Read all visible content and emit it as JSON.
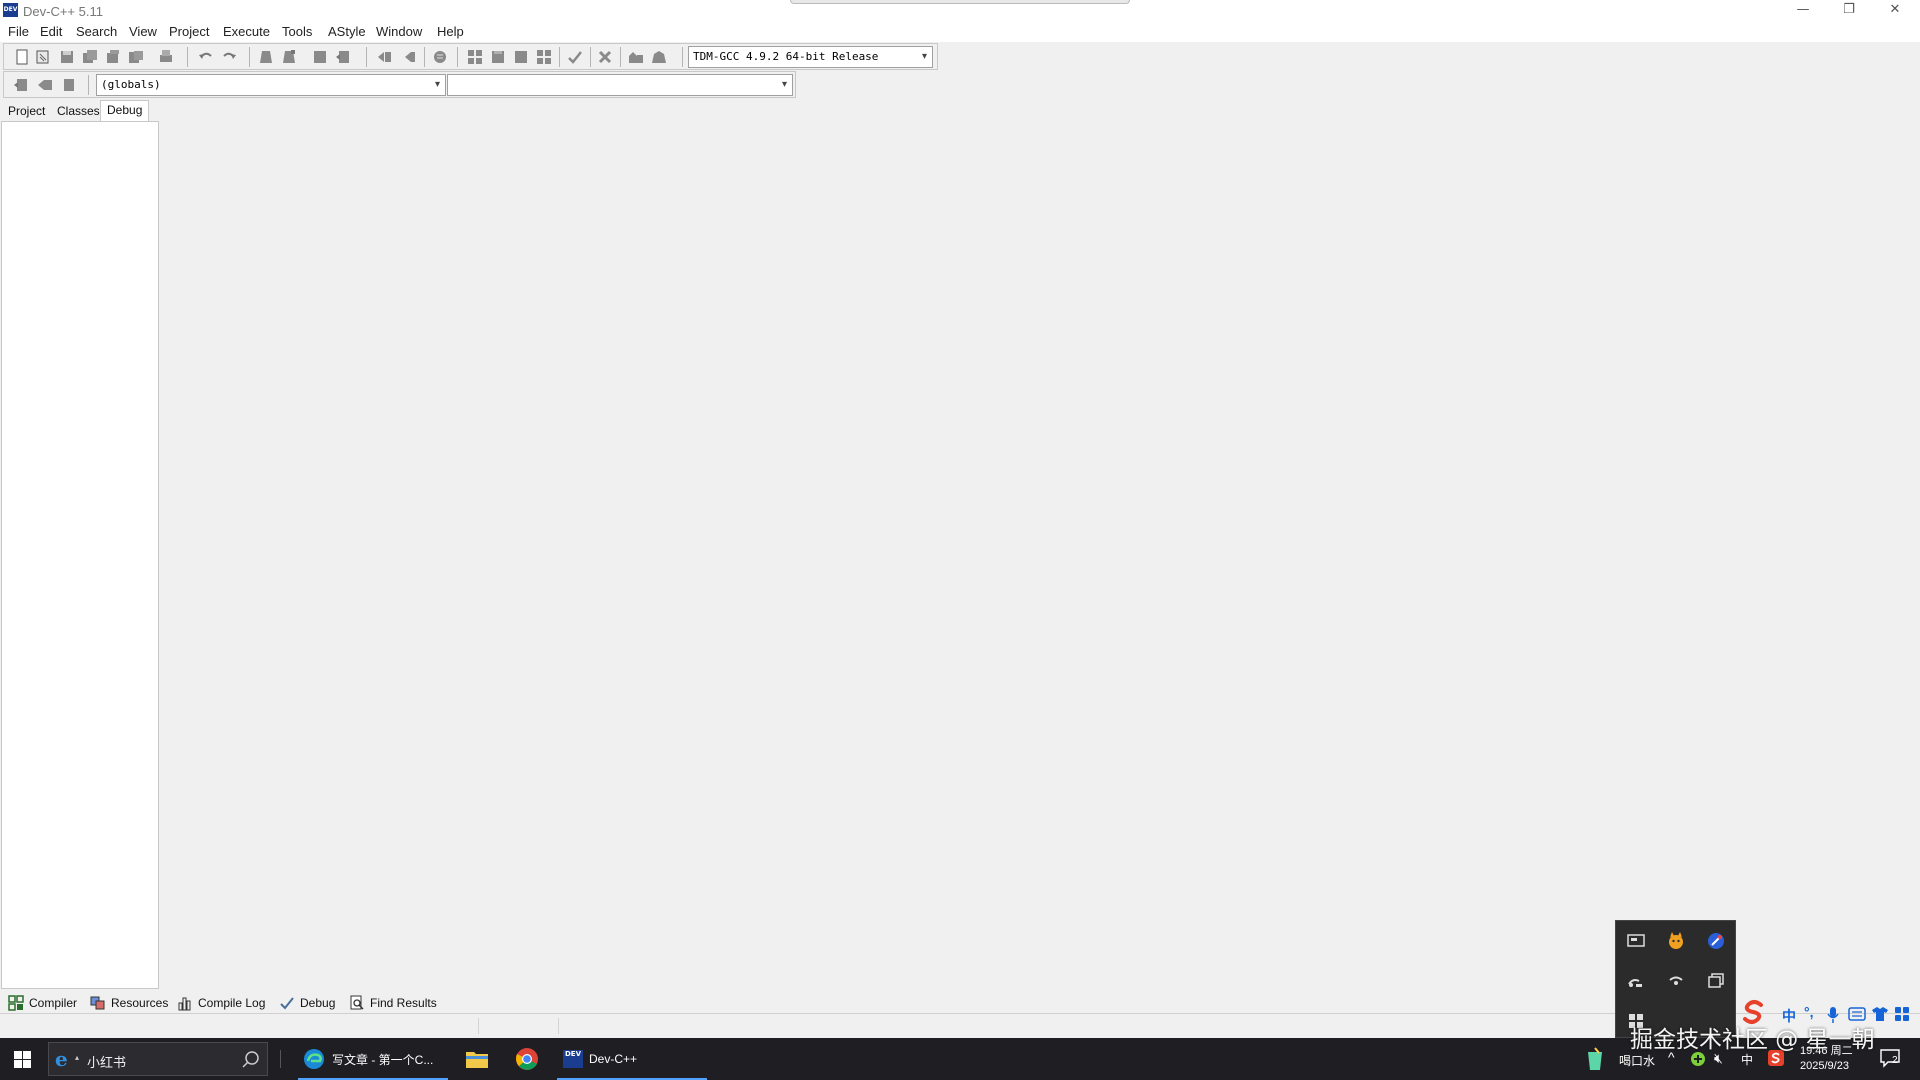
{
  "window": {
    "title": "Dev-C++ 5.11",
    "app_icon_text": "DEV",
    "min_glyph": "—",
    "restore_glyph": "❐",
    "close_glyph": "✕"
  },
  "menu": [
    "File",
    "Edit",
    "Search",
    "View",
    "Project",
    "Execute",
    "Tools",
    "AStyle",
    "Window",
    "Help"
  ],
  "toolbar": {
    "compiler_select": "TDM-GCC 4.9.2 64-bit Release",
    "scope_select": "(globals)",
    "member_select": ""
  },
  "left_tabs": [
    "Project",
    "Classes",
    "Debug"
  ],
  "left_tabs_active": "Debug",
  "bottom_tabs": [
    "Compiler",
    "Resources",
    "Compile Log",
    "Debug",
    "Find Results"
  ],
  "taskbar": {
    "search_text": "小红书",
    "apps": [
      {
        "label": "写文章 - 第一个C..."
      },
      {
        "label": ""
      },
      {
        "label": ""
      },
      {
        "label": "Dev-C++",
        "icon_text": "DEV"
      }
    ],
    "tray_label": "喝口水",
    "tray_lang": "中",
    "time": "19:46 周二",
    "date": "2025/9/23",
    "notification_count": "2"
  },
  "ime": {
    "lang_glyph": "中",
    "punct_glyph": "°,"
  },
  "watermark": "掘金技术社区 @ 星一朝",
  "colors": {
    "taskbar_bg": "#1f1f23",
    "accent_blue": "#4fa3ff",
    "sogou_red": "#e8412b",
    "devcpp_blue": "#1a3d8f"
  }
}
